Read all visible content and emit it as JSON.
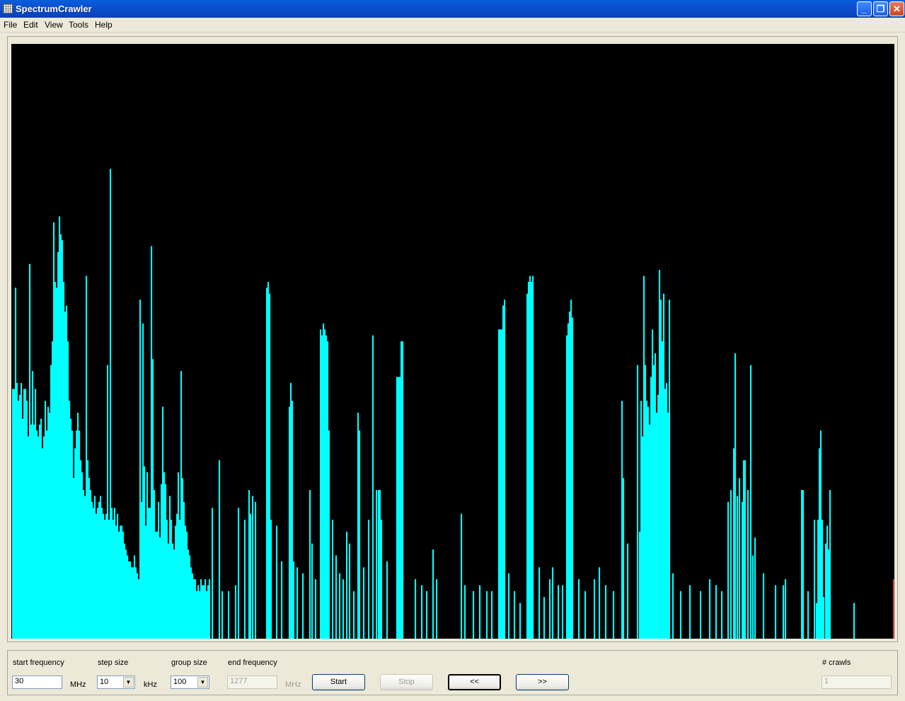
{
  "window": {
    "title": "SpectrumCrawler",
    "minimize": "_",
    "maximize": "❐",
    "close": "✕"
  },
  "menu": [
    "File",
    "Edit",
    "View",
    "Tools",
    "Help"
  ],
  "colors": {
    "plot_background": "#000000",
    "trace": "#00ffff",
    "end_marker": "#ff5050"
  },
  "controls": {
    "start_frequency": {
      "label": "start frequency",
      "value": "30",
      "unit": "MHz"
    },
    "step_size": {
      "label": "step size",
      "value": "10",
      "unit": "kHz"
    },
    "group_size": {
      "label": "group size",
      "value": "100"
    },
    "end_frequency": {
      "label": "end frequency",
      "value": "1277",
      "unit": "MHz"
    },
    "start_button": "Start",
    "stop_button": "Stop",
    "prev_button": "<<",
    "next_button": ">>",
    "crawls": {
      "label": "# crawls",
      "value": "1"
    }
  },
  "chart_data": {
    "type": "bar",
    "title": "",
    "xlabel": "",
    "ylabel": "",
    "ylim": [
      0,
      100
    ],
    "xlim": [
      0,
      1248
    ],
    "peaks": [
      [
        1,
        42
      ],
      [
        3,
        42
      ],
      [
        5,
        59
      ],
      [
        7,
        43
      ],
      [
        9,
        40
      ],
      [
        11,
        41
      ],
      [
        13,
        43
      ],
      [
        15,
        37
      ],
      [
        17,
        42
      ],
      [
        19,
        42
      ],
      [
        21,
        40
      ],
      [
        23,
        34
      ],
      [
        25,
        63
      ],
      [
        27,
        36
      ],
      [
        29,
        45
      ],
      [
        31,
        36
      ],
      [
        33,
        42
      ],
      [
        35,
        35
      ],
      [
        37,
        34
      ],
      [
        39,
        36
      ],
      [
        41,
        37
      ],
      [
        43,
        32
      ],
      [
        45,
        34
      ],
      [
        47,
        40
      ],
      [
        49,
        35
      ],
      [
        51,
        39
      ],
      [
        53,
        38
      ],
      [
        55,
        46
      ],
      [
        57,
        50
      ],
      [
        59,
        70
      ],
      [
        61,
        60
      ],
      [
        63,
        59
      ],
      [
        65,
        65
      ],
      [
        67,
        71
      ],
      [
        69,
        68
      ],
      [
        71,
        67
      ],
      [
        73,
        60
      ],
      [
        75,
        55
      ],
      [
        77,
        56
      ],
      [
        79,
        50
      ],
      [
        81,
        40
      ],
      [
        83,
        37
      ],
      [
        85,
        35
      ],
      [
        87,
        27
      ],
      [
        89,
        32
      ],
      [
        91,
        35
      ],
      [
        93,
        38
      ],
      [
        95,
        35
      ],
      [
        97,
        30
      ],
      [
        99,
        28
      ],
      [
        101,
        25
      ],
      [
        103,
        24
      ],
      [
        105,
        61
      ],
      [
        107,
        30
      ],
      [
        109,
        27
      ],
      [
        111,
        25
      ],
      [
        113,
        23
      ],
      [
        115,
        22
      ],
      [
        117,
        24
      ],
      [
        119,
        21
      ],
      [
        121,
        22
      ],
      [
        123,
        23
      ],
      [
        125,
        24
      ],
      [
        127,
        22
      ],
      [
        129,
        21
      ],
      [
        131,
        20
      ],
      [
        133,
        21
      ],
      [
        135,
        46
      ],
      [
        137,
        20
      ],
      [
        139,
        79
      ],
      [
        141,
        22
      ],
      [
        143,
        20
      ],
      [
        145,
        22
      ],
      [
        147,
        19
      ],
      [
        149,
        21
      ],
      [
        151,
        18
      ],
      [
        153,
        19
      ],
      [
        155,
        19
      ],
      [
        157,
        18
      ],
      [
        159,
        16
      ],
      [
        161,
        15
      ],
      [
        163,
        14
      ],
      [
        165,
        13
      ],
      [
        167,
        13
      ],
      [
        169,
        12
      ],
      [
        171,
        12
      ],
      [
        173,
        14
      ],
      [
        175,
        12
      ],
      [
        177,
        11
      ],
      [
        179,
        10
      ],
      [
        181,
        57
      ],
      [
        183,
        23
      ],
      [
        185,
        53
      ],
      [
        187,
        29
      ],
      [
        189,
        19
      ],
      [
        191,
        28
      ],
      [
        193,
        22
      ],
      [
        195,
        22
      ],
      [
        197,
        66
      ],
      [
        199,
        47
      ],
      [
        201,
        25
      ],
      [
        203,
        18
      ],
      [
        205,
        18
      ],
      [
        207,
        23
      ],
      [
        209,
        17
      ],
      [
        211,
        26
      ],
      [
        213,
        39
      ],
      [
        215,
        28
      ],
      [
        217,
        26
      ],
      [
        219,
        20
      ],
      [
        221,
        16
      ],
      [
        223,
        24
      ],
      [
        225,
        20
      ],
      [
        227,
        16
      ],
      [
        229,
        15
      ],
      [
        231,
        19
      ],
      [
        233,
        21
      ],
      [
        235,
        28
      ],
      [
        237,
        20
      ],
      [
        239,
        45
      ],
      [
        241,
        27
      ],
      [
        243,
        23
      ],
      [
        245,
        19
      ],
      [
        247,
        18
      ],
      [
        249,
        15
      ],
      [
        251,
        14
      ],
      [
        253,
        12
      ],
      [
        255,
        11
      ],
      [
        257,
        10
      ],
      [
        259,
        10
      ],
      [
        261,
        8
      ],
      [
        263,
        9
      ],
      [
        265,
        8
      ],
      [
        267,
        10
      ],
      [
        269,
        9
      ],
      [
        271,
        9
      ],
      [
        273,
        10
      ],
      [
        275,
        8
      ],
      [
        277,
        9
      ],
      [
        279,
        10
      ],
      [
        283,
        22
      ],
      [
        293,
        30
      ],
      [
        297,
        8
      ],
      [
        306,
        8
      ],
      [
        316,
        9
      ],
      [
        320,
        22
      ],
      [
        329,
        20
      ],
      [
        335,
        25
      ],
      [
        337,
        21
      ],
      [
        340,
        24
      ],
      [
        344,
        23
      ],
      [
        360,
        59
      ],
      [
        362,
        60
      ],
      [
        364,
        58
      ],
      [
        366,
        20
      ],
      [
        374,
        19
      ],
      [
        381,
        13
      ],
      [
        392,
        39
      ],
      [
        394,
        43
      ],
      [
        396,
        40
      ],
      [
        398,
        13
      ],
      [
        403,
        12
      ],
      [
        411,
        11
      ],
      [
        421,
        25
      ],
      [
        424,
        16
      ],
      [
        429,
        10
      ],
      [
        436,
        52
      ],
      [
        438,
        51
      ],
      [
        440,
        53
      ],
      [
        442,
        52
      ],
      [
        444,
        51
      ],
      [
        446,
        50
      ],
      [
        448,
        35
      ],
      [
        453,
        20
      ],
      [
        458,
        14
      ],
      [
        463,
        11
      ],
      [
        468,
        10
      ],
      [
        473,
        18
      ],
      [
        477,
        16
      ],
      [
        483,
        8
      ],
      [
        489,
        38
      ],
      [
        491,
        35
      ],
      [
        497,
        12
      ],
      [
        504,
        20
      ],
      [
        510,
        51
      ],
      [
        515,
        25
      ],
      [
        518,
        25
      ],
      [
        520,
        25
      ],
      [
        522,
        20
      ],
      [
        530,
        13
      ],
      [
        544,
        44
      ],
      [
        546,
        44
      ],
      [
        548,
        44
      ],
      [
        550,
        50
      ],
      [
        552,
        50
      ],
      [
        570,
        10
      ],
      [
        579,
        9
      ],
      [
        586,
        8
      ],
      [
        595,
        15
      ],
      [
        600,
        10
      ],
      [
        635,
        21
      ],
      [
        640,
        9
      ],
      [
        652,
        8
      ],
      [
        661,
        9
      ],
      [
        671,
        8
      ],
      [
        678,
        8
      ],
      [
        688,
        52
      ],
      [
        690,
        52
      ],
      [
        692,
        52
      ],
      [
        694,
        56
      ],
      [
        696,
        57
      ],
      [
        702,
        11
      ],
      [
        710,
        8
      ],
      [
        718,
        6
      ],
      [
        728,
        58
      ],
      [
        730,
        60
      ],
      [
        732,
        61
      ],
      [
        734,
        60
      ],
      [
        736,
        61
      ],
      [
        745,
        12
      ],
      [
        752,
        7
      ],
      [
        760,
        10
      ],
      [
        764,
        12
      ],
      [
        772,
        9
      ],
      [
        778,
        9
      ],
      [
        784,
        51
      ],
      [
        786,
        53
      ],
      [
        788,
        55
      ],
      [
        790,
        57
      ],
      [
        792,
        54
      ],
      [
        801,
        10
      ],
      [
        810,
        8
      ],
      [
        823,
        10
      ],
      [
        830,
        12
      ],
      [
        839,
        9
      ],
      [
        850,
        8
      ],
      [
        862,
        40
      ],
      [
        864,
        27
      ],
      [
        870,
        16
      ],
      [
        884,
        46
      ],
      [
        887,
        18
      ],
      [
        889,
        40
      ],
      [
        891,
        34
      ],
      [
        893,
        61
      ],
      [
        895,
        46
      ],
      [
        897,
        40
      ],
      [
        899,
        39
      ],
      [
        901,
        36
      ],
      [
        903,
        44
      ],
      [
        905,
        52
      ],
      [
        907,
        46
      ],
      [
        909,
        48
      ],
      [
        911,
        38
      ],
      [
        913,
        41
      ],
      [
        915,
        62
      ],
      [
        917,
        57
      ],
      [
        919,
        50
      ],
      [
        921,
        58
      ],
      [
        923,
        42
      ],
      [
        925,
        43
      ],
      [
        927,
        38
      ],
      [
        929,
        57
      ],
      [
        934,
        11
      ],
      [
        945,
        8
      ],
      [
        958,
        9
      ],
      [
        973,
        8
      ],
      [
        986,
        10
      ],
      [
        995,
        9
      ],
      [
        1003,
        8
      ],
      [
        1012,
        23
      ],
      [
        1016,
        25
      ],
      [
        1020,
        32
      ],
      [
        1022,
        48
      ],
      [
        1025,
        24
      ],
      [
        1028,
        27
      ],
      [
        1032,
        23
      ],
      [
        1034,
        30
      ],
      [
        1036,
        30
      ],
      [
        1040,
        25
      ],
      [
        1044,
        46
      ],
      [
        1047,
        14
      ],
      [
        1050,
        17
      ],
      [
        1062,
        11
      ],
      [
        1079,
        9
      ],
      [
        1090,
        9
      ],
      [
        1093,
        10
      ],
      [
        1116,
        25
      ],
      [
        1118,
        25
      ],
      [
        1125,
        8
      ],
      [
        1134,
        20
      ],
      [
        1137,
        6
      ],
      [
        1139,
        20
      ],
      [
        1141,
        32
      ],
      [
        1143,
        35
      ],
      [
        1145,
        20
      ],
      [
        1147,
        7
      ],
      [
        1150,
        16
      ],
      [
        1152,
        19
      ],
      [
        1154,
        15
      ],
      [
        1156,
        25
      ],
      [
        1190,
        6
      ],
      [
        1246,
        10
      ]
    ]
  }
}
